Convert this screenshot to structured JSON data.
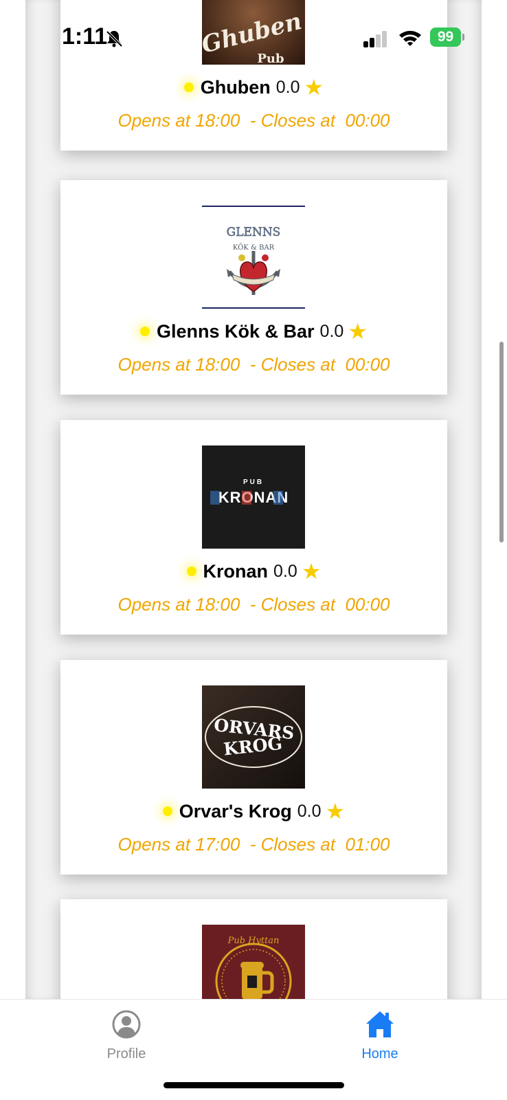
{
  "status_bar": {
    "time": "1:11",
    "battery": "99"
  },
  "bars": [
    {
      "name": "Ghuben",
      "rating": "0.0",
      "hours": "Opens at 18:00  - Closes at  00:00",
      "logo_text": [
        "Ghuben",
        "Pub"
      ]
    },
    {
      "name": "Glenns Kök & Bar",
      "rating": "0.0",
      "hours": "Opens at 18:00  - Closes at  00:00",
      "logo_text": [
        "GLENNS",
        "KÖK & BAR"
      ]
    },
    {
      "name": "Kronan",
      "rating": "0.0",
      "hours": "Opens at 18:00  - Closes at  00:00",
      "logo_text": [
        "PUB",
        "KRONAN"
      ]
    },
    {
      "name": "Orvar's Krog",
      "rating": "0.0",
      "hours": "Opens at 17:00  - Closes at  01:00",
      "logo_text": [
        "ORVARS",
        "KROG"
      ]
    },
    {
      "name": "",
      "rating": "",
      "hours": "",
      "logo_text": [
        "Pub Hyttan"
      ]
    }
  ],
  "tabs": [
    {
      "label": "Profile",
      "icon": "person-circle-icon"
    },
    {
      "label": "Home",
      "icon": "house-icon",
      "active": true
    }
  ],
  "colors": {
    "accent": "#1a7cf5",
    "hours": "#f0a500",
    "star": "#f7cc00",
    "open_dot": "#ffee00"
  }
}
